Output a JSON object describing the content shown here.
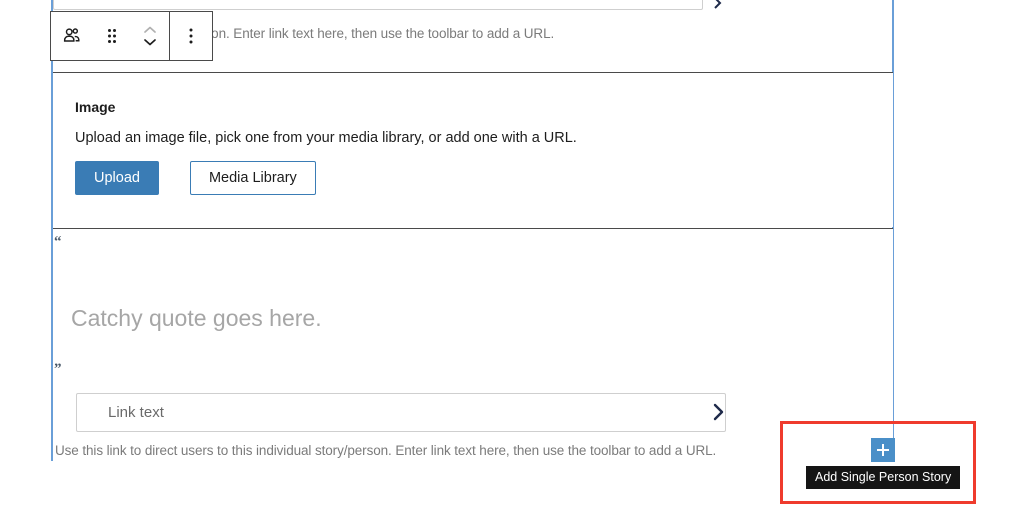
{
  "editor": {
    "selection_color": "#6a9fd8",
    "block_border_color": "#4a4a4a"
  },
  "toolbar": {
    "items": [
      {
        "name": "single-person-story-icon",
        "label": "Single Person Story"
      },
      {
        "name": "drag-handle-icon",
        "label": "Drag"
      },
      {
        "name": "move-up-down-icon",
        "label": "Move up or down"
      },
      {
        "name": "more-options-icon",
        "label": "Options"
      }
    ]
  },
  "top_link_row": {
    "help_text": "to this individual story/person. Enter link text here, then use the toolbar to add a URL.",
    "chevron": "›"
  },
  "image_block": {
    "title": "Image",
    "description": "Upload an image file, pick one from your media library, or add one with a URL.",
    "upload_label": "Upload",
    "media_library_label": "Media Library",
    "upload_color": "#3a7cb5"
  },
  "quote_block": {
    "open_quote": "“",
    "close_quote": "”",
    "placeholder": "Catchy quote goes here.",
    "link_field": {
      "value": "",
      "placeholder": "Link text",
      "chevron": "›"
    },
    "help_text": "Use this link to direct users to this individual story/person. Enter link text here, then use the toolbar to add a URL."
  },
  "inserter": {
    "add_button_label": "+",
    "add_button_color": "#4a8fc8",
    "tooltip": "Add Single Person Story"
  },
  "annotation": {
    "highlight_color": "#ef3b2d"
  }
}
